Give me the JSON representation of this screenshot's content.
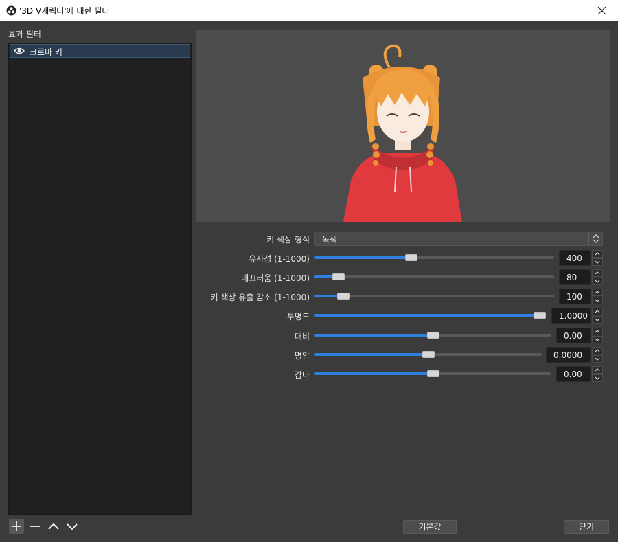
{
  "window": {
    "title": "'3D V캐릭터'에 대한 필터"
  },
  "left": {
    "section_label": "효과 필터",
    "filters": [
      {
        "name": "크로마 키",
        "visible": true
      }
    ]
  },
  "properties": {
    "key_color_type": {
      "label": "키 색상 형식",
      "value": "녹색"
    },
    "similarity": {
      "label": "유사성 (1-1000)",
      "value": "400",
      "fraction": 0.4
    },
    "smoothness": {
      "label": "매끄러움 (1-1000)",
      "value": "80",
      "fraction": 0.08
    },
    "spill": {
      "label": "키 색상 유출 감소 (1-1000)",
      "value": "100",
      "fraction": 0.1
    },
    "opacity": {
      "label": "투명도",
      "value": "1.0000",
      "fraction": 1.0
    },
    "contrast": {
      "label": "대비",
      "value": "0.00",
      "fraction": 0.5
    },
    "brightness": {
      "label": "명암",
      "value": "0.0000",
      "fraction": 0.5
    },
    "gamma": {
      "label": "감마",
      "value": "0.00",
      "fraction": 0.5
    }
  },
  "footer": {
    "defaults_label": "기본값",
    "close_label": "닫기"
  },
  "colors": {
    "accent": "#2f80e0",
    "background": "#3b3b3b",
    "hoodie": "#e03a3e",
    "hair": "#f0a040"
  }
}
